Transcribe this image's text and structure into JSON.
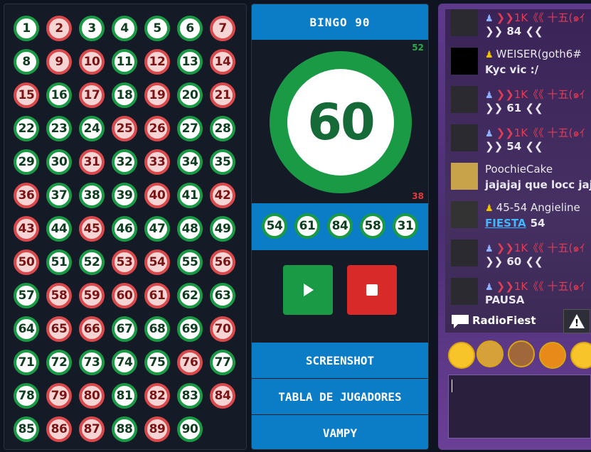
{
  "board": {
    "balls": [
      {
        "n": "1",
        "s": "g"
      },
      {
        "n": "2",
        "s": "r"
      },
      {
        "n": "3",
        "s": "g"
      },
      {
        "n": "4",
        "s": "g"
      },
      {
        "n": "5",
        "s": "g"
      },
      {
        "n": "6",
        "s": "g"
      },
      {
        "n": "7",
        "s": "r"
      },
      {
        "n": "8",
        "s": "g"
      },
      {
        "n": "9",
        "s": "r"
      },
      {
        "n": "10",
        "s": "r"
      },
      {
        "n": "11",
        "s": "g"
      },
      {
        "n": "12",
        "s": "r"
      },
      {
        "n": "13",
        "s": "g"
      },
      {
        "n": "14",
        "s": "r"
      },
      {
        "n": "15",
        "s": "r"
      },
      {
        "n": "16",
        "s": "g"
      },
      {
        "n": "17",
        "s": "r"
      },
      {
        "n": "18",
        "s": "g"
      },
      {
        "n": "19",
        "s": "r"
      },
      {
        "n": "20",
        "s": "g"
      },
      {
        "n": "21",
        "s": "r"
      },
      {
        "n": "22",
        "s": "g"
      },
      {
        "n": "23",
        "s": "g"
      },
      {
        "n": "24",
        "s": "g"
      },
      {
        "n": "25",
        "s": "r"
      },
      {
        "n": "26",
        "s": "r"
      },
      {
        "n": "27",
        "s": "g"
      },
      {
        "n": "28",
        "s": "g"
      },
      {
        "n": "29",
        "s": "g"
      },
      {
        "n": "30",
        "s": "g"
      },
      {
        "n": "31",
        "s": "r"
      },
      {
        "n": "32",
        "s": "g"
      },
      {
        "n": "33",
        "s": "r"
      },
      {
        "n": "34",
        "s": "g"
      },
      {
        "n": "35",
        "s": "g"
      },
      {
        "n": "36",
        "s": "r"
      },
      {
        "n": "37",
        "s": "g"
      },
      {
        "n": "38",
        "s": "g"
      },
      {
        "n": "39",
        "s": "g"
      },
      {
        "n": "40",
        "s": "r"
      },
      {
        "n": "41",
        "s": "g"
      },
      {
        "n": "42",
        "s": "r"
      },
      {
        "n": "43",
        "s": "r"
      },
      {
        "n": "44",
        "s": "g"
      },
      {
        "n": "45",
        "s": "r"
      },
      {
        "n": "46",
        "s": "g"
      },
      {
        "n": "47",
        "s": "g"
      },
      {
        "n": "48",
        "s": "g"
      },
      {
        "n": "49",
        "s": "g"
      },
      {
        "n": "50",
        "s": "r"
      },
      {
        "n": "51",
        "s": "g"
      },
      {
        "n": "52",
        "s": "g"
      },
      {
        "n": "53",
        "s": "r"
      },
      {
        "n": "54",
        "s": "r"
      },
      {
        "n": "55",
        "s": "g"
      },
      {
        "n": "56",
        "s": "r"
      },
      {
        "n": "57",
        "s": "g"
      },
      {
        "n": "58",
        "s": "r"
      },
      {
        "n": "59",
        "s": "r"
      },
      {
        "n": "60",
        "s": "r"
      },
      {
        "n": "61",
        "s": "r"
      },
      {
        "n": "62",
        "s": "g"
      },
      {
        "n": "63",
        "s": "g"
      },
      {
        "n": "64",
        "s": "g"
      },
      {
        "n": "65",
        "s": "r"
      },
      {
        "n": "66",
        "s": "r"
      },
      {
        "n": "67",
        "s": "g"
      },
      {
        "n": "68",
        "s": "g"
      },
      {
        "n": "69",
        "s": "g"
      },
      {
        "n": "70",
        "s": "r"
      },
      {
        "n": "71",
        "s": "g"
      },
      {
        "n": "72",
        "s": "g"
      },
      {
        "n": "73",
        "s": "g"
      },
      {
        "n": "74",
        "s": "g"
      },
      {
        "n": "75",
        "s": "g"
      },
      {
        "n": "76",
        "s": "r"
      },
      {
        "n": "77",
        "s": "g"
      },
      {
        "n": "78",
        "s": "g"
      },
      {
        "n": "79",
        "s": "r"
      },
      {
        "n": "80",
        "s": "r"
      },
      {
        "n": "81",
        "s": "g"
      },
      {
        "n": "82",
        "s": "r"
      },
      {
        "n": "83",
        "s": "g"
      },
      {
        "n": "84",
        "s": "r"
      },
      {
        "n": "85",
        "s": "g"
      },
      {
        "n": "86",
        "s": "r"
      },
      {
        "n": "87",
        "s": "r"
      },
      {
        "n": "88",
        "s": "g"
      },
      {
        "n": "89",
        "s": "r"
      },
      {
        "n": "90",
        "s": "g"
      }
    ]
  },
  "game": {
    "title": "BINGO 90",
    "count_green": "52",
    "count_red": "38",
    "current_number": "60",
    "recent": [
      "54",
      "61",
      "84",
      "58",
      "31"
    ],
    "play_icon": "play-icon",
    "stop_icon": "stop-icon",
    "screenshot_label": "SCREENSHOT",
    "players_label": "TABLA DE JUGADORES",
    "vampy_label": "VAMPY"
  },
  "chat": {
    "messages": [
      {
        "nick": "❯❯1K《《 十五(๑ｲ",
        "text": "❯❯ 84 ❮❮",
        "icon": "b"
      },
      {
        "nick": "WEISER(goth6#",
        "text": "Kyc vic :/",
        "icon": "y",
        "white": true
      },
      {
        "nick": "❯❯1K《《 十五(๑ｲ",
        "text": "❯❯ 61 ❮❮",
        "icon": "b"
      },
      {
        "nick": "❯❯1K《《 十五(๑ｲ",
        "text": "❯❯ 54 ❮❮",
        "icon": "b"
      },
      {
        "nick": "PoochieCake",
        "text": "jajajaj que locc jaj",
        "icon": "",
        "white": true
      },
      {
        "nick": "45-54 Angieline",
        "text": "54",
        "link": "FIESTA",
        "icon": "y",
        "white": true
      },
      {
        "nick": "❯❯1K《《 十五(๑ｲ",
        "text": "❯❯ 60 ❮❮",
        "icon": "b"
      },
      {
        "nick": "❯❯1K《《 十五(๑ｲ",
        "text": "PAUSA",
        "icon": "b"
      }
    ],
    "footer_nick": "RadioFiest",
    "warn_symbol": "!"
  },
  "colors": {
    "green": "#1a9a44",
    "red": "#d9484a",
    "blue": "#0b7cc6",
    "chat_purple": "#5e3a8c"
  }
}
